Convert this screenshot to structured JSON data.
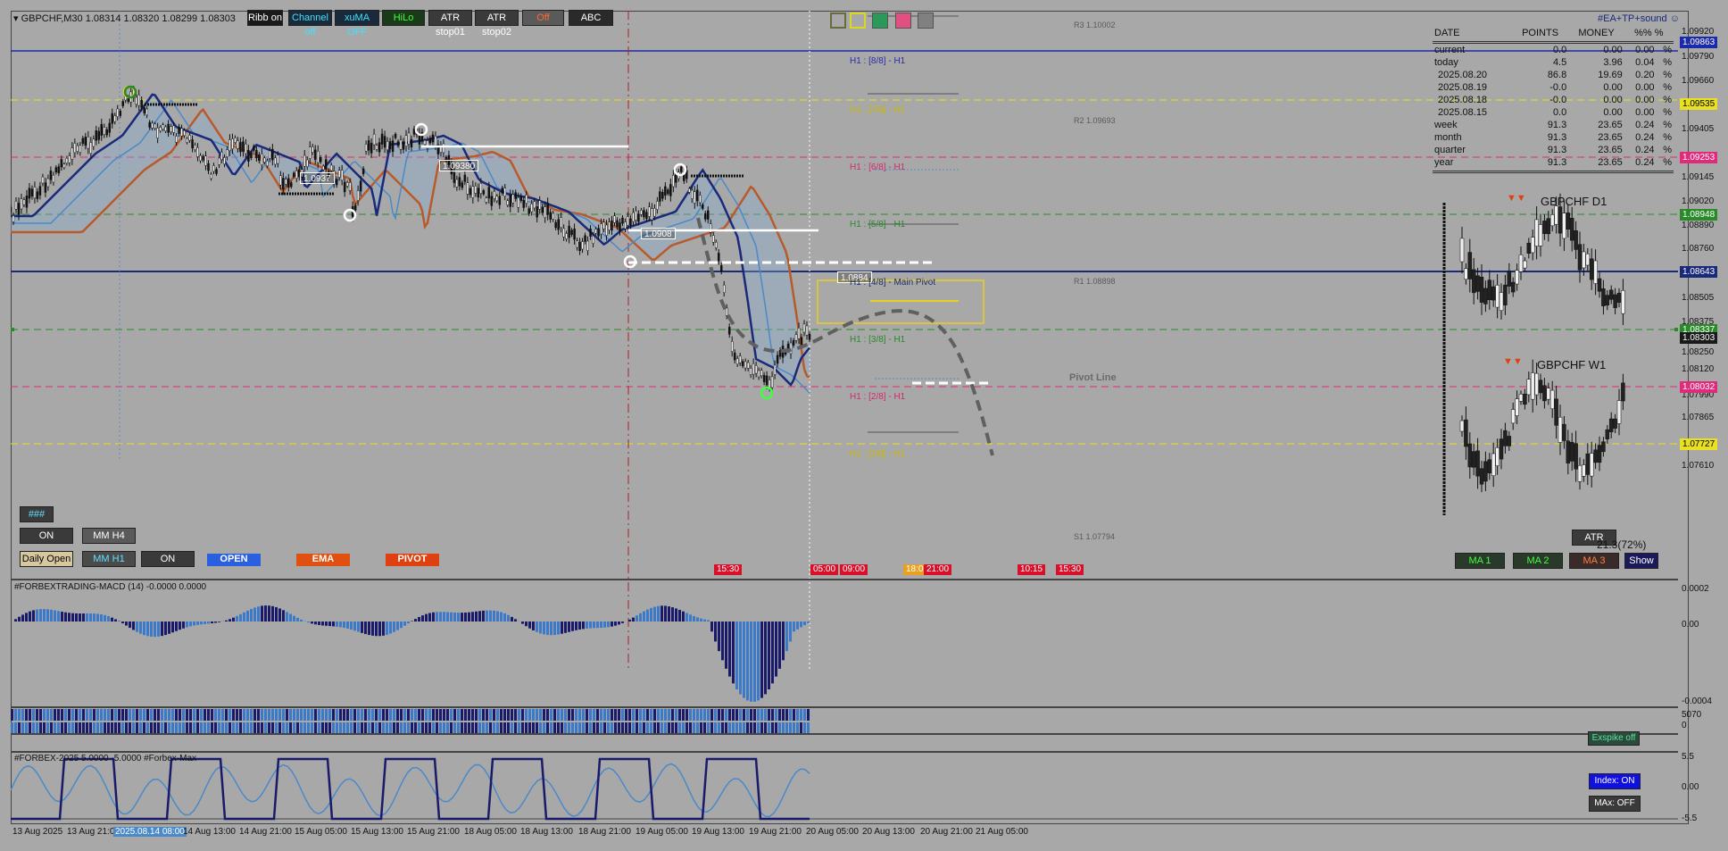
{
  "symbol": {
    "title": "GBPCHF,M30  1.08314 1.08320 1.08299 1.08303"
  },
  "toolbar": [
    {
      "label": "Ribb on",
      "bg": "#1a1a1a",
      "fg": "#ffffff"
    },
    {
      "label": "Channel off",
      "bg": "#1a2a3a",
      "fg": "#40e0ff"
    },
    {
      "label": "xuMA OFF",
      "bg": "#1a2a3a",
      "fg": "#40e0ff"
    },
    {
      "label": "HiLo",
      "bg": "#1a3a1a",
      "fg": "#40ff40"
    },
    {
      "label": "ATR stop01",
      "bg": "#3a3a3a",
      "fg": "#ffffff"
    },
    {
      "label": "ATR stop02",
      "bg": "#3a3a3a",
      "fg": "#ffffff"
    },
    {
      "label": "Off",
      "bg": "#5a5a5a",
      "fg": "#ff6a30"
    },
    {
      "label": "ABC",
      "bg": "#2a2a2a",
      "fg": "#ffffff"
    }
  ],
  "swatches": [
    "#6a6a3a",
    "#d8d820",
    "#2a9a5a",
    "#e05080",
    "#808080"
  ],
  "ea_label": "#EA+TP+sound",
  "stats": {
    "headers": [
      "DATE",
      "POINTS",
      "MONEY",
      "%%  %"
    ],
    "rows": [
      [
        "current",
        "0.0",
        "0.00",
        "0.00",
        "%"
      ],
      [
        "today",
        "4.5",
        "3.96",
        "0.04",
        "%"
      ],
      [
        "2025.08.20",
        "86.8",
        "19.69",
        "0.20",
        "%"
      ],
      [
        "2025.08.19",
        "-0.0",
        "0.00",
        "0.00",
        "%"
      ],
      [
        "2025.08.18",
        "-0.0",
        "0.00",
        "0.00",
        "%"
      ],
      [
        "2025.08.15",
        "0.0",
        "0.00",
        "0.00",
        "%"
      ],
      [
        "week",
        "91.3",
        "23.65",
        "0.24",
        "%"
      ],
      [
        "month",
        "91.3",
        "23.65",
        "0.24",
        "%"
      ],
      [
        "quarter",
        "91.3",
        "23.65",
        "0.24",
        "%"
      ],
      [
        "year",
        "91.3",
        "23.65",
        "0.24",
        "%"
      ]
    ]
  },
  "mm_labels": [
    {
      "text": "H1 : [8/8] - H1",
      "color": "#2a2aa8"
    },
    {
      "text": "H1 : [7/8] - H1",
      "color": "#c8b800"
    },
    {
      "text": "H1 : [6/8] - H1",
      "color": "#d02a6a"
    },
    {
      "text": "H1 : [5/8] - H1",
      "color": "#2a8a2a"
    },
    {
      "text": "H1 : [4/8] - Main Pivot",
      "color": "#1a2a7a"
    },
    {
      "text": "H1 : [3/8] - H1",
      "color": "#2a8a2a"
    },
    {
      "text": "H1 : [2/8] - H1",
      "color": "#d02a6a"
    },
    {
      "text": "H1 : [1/8] - H1",
      "color": "#c8b800"
    }
  ],
  "pivots": [
    "R3 1.10002",
    "R2 1.09693",
    "R1 1.08898",
    "Pivot Line",
    "S1 1.07794"
  ],
  "price_axis": [
    "1.09920",
    "1.09863",
    "1.09790",
    "1.09660",
    "1.09535",
    "1.09405",
    "1.09253",
    "1.09145",
    "1.09020",
    "1.08948",
    "1.08890",
    "1.08760",
    "1.08643",
    "1.08505",
    "1.08375",
    "1.08337",
    "1.08303",
    "1.08250",
    "1.08120",
    "1.08032",
    "1.07990",
    "1.07865",
    "1.07727",
    "1.07610"
  ],
  "price_tags": [
    {
      "text": "1.09863",
      "bg": "#1a2aa8",
      "fg": "#ffffff"
    },
    {
      "text": "1.09535",
      "bg": "#e8e020",
      "fg": "#000000"
    },
    {
      "text": "1.09253",
      "bg": "#e02a7a",
      "fg": "#ffffff"
    },
    {
      "text": "1.08948",
      "bg": "#2a8a2a",
      "fg": "#ffffff"
    },
    {
      "text": "1.08643",
      "bg": "#1a2a7a",
      "fg": "#ffffff"
    },
    {
      "text": "1.08337",
      "bg": "#2a8a2a",
      "fg": "#ffffff"
    },
    {
      "text": "1.08303",
      "bg": "#1a1a1a",
      "fg": "#ffffff"
    },
    {
      "text": "1.08032",
      "bg": "#e02a7a",
      "fg": "#ffffff"
    },
    {
      "text": "1.07727",
      "bg": "#e8e020",
      "fg": "#000000"
    }
  ],
  "price_labels": [
    "1.09380",
    "1.0937",
    "1.0908",
    "1.0884"
  ],
  "panels": [
    {
      "label": "GBPCHF  D1"
    },
    {
      "label": "GBPCHF  W1"
    }
  ],
  "left_buttons": [
    {
      "label": "###",
      "bg": "#3a3a3a",
      "fg": "#60e0ff"
    },
    {
      "label": "ON",
      "bg": "#3a3a3a",
      "fg": "#ffffff"
    },
    {
      "label": "MM H4",
      "bg": "#5a5a5a",
      "fg": "#ffffff"
    },
    {
      "label": "Daily Open",
      "bg": "#d8c8a0",
      "fg": "#000000"
    },
    {
      "label": "MM H1",
      "bg": "#4a4a4a",
      "fg": "#60e0ff"
    },
    {
      "label": "ON",
      "bg": "#3a3a3a",
      "fg": "#ffffff"
    },
    {
      "label": "OPEN",
      "bg": "#2a60e0",
      "fg": "#ffffff"
    },
    {
      "label": "EMA",
      "bg": "#e05010",
      "fg": "#ffffff"
    },
    {
      "label": "PIVOT",
      "bg": "#e04010",
      "fg": "#ffffff"
    }
  ],
  "session_tags": [
    "15:30",
    "05:00",
    "09:00",
    "18:00",
    "21:00",
    "10:15",
    "15:30"
  ],
  "right_buttons": [
    {
      "label": "ATR",
      "bg": "#3a3a3a",
      "fg": "#ffffff"
    },
    {
      "label": "MA 1",
      "bg": "#2a3a2a",
      "fg": "#40ff40"
    },
    {
      "label": "MA 2",
      "bg": "#2a3a2a",
      "fg": "#40ff40"
    },
    {
      "label": "MA 3",
      "bg": "#3a2a2a",
      "fg": "#ff8040"
    },
    {
      "label": "Show",
      "bg": "#1a1a5a",
      "fg": "#ffffff"
    }
  ],
  "atr_value": "21.3(72%)",
  "macd": {
    "label": "#FORBEXTRADING-MACD (14) -0.0000 0.0000",
    "axis": [
      "0.0002",
      "0.00",
      "-0.0004"
    ]
  },
  "exspike": {
    "label": "Exspike off",
    "axis": [
      "5070",
      "0"
    ]
  },
  "forbex": {
    "label": "#FORBEX-2025 5.0000 -5.0000  #Forbex-Max",
    "axis": [
      "5.5",
      "0.00",
      "-5.5"
    ],
    "index_btn": "Index: ON",
    "max_btn": "MAx: OFF"
  },
  "time_axis": [
    "13 Aug 2025",
    "13 Aug 21:00",
    "2025.08.14 08:00",
    "14 Aug 13:00",
    "14 Aug 21:00",
    "15 Aug 05:00",
    "15 Aug 13:00",
    "15 Aug 21:00",
    "18 Aug 05:00",
    "18 Aug 13:00",
    "18 Aug 21:00",
    "19 Aug 05:00",
    "19 Aug 13:00",
    "19 Aug 21:00",
    "20 Aug 05:00",
    "20 Aug 13:00",
    "20 Aug 21:00",
    "21 Aug 05:00"
  ],
  "colors": {
    "ema_fast": "#1a2a7a",
    "ema_mid": "#4a8ac8",
    "ema_slow": "#b85a2a",
    "macd_bar": "#3a7ac8",
    "macd_bar_dark": "#1a1a6a"
  }
}
